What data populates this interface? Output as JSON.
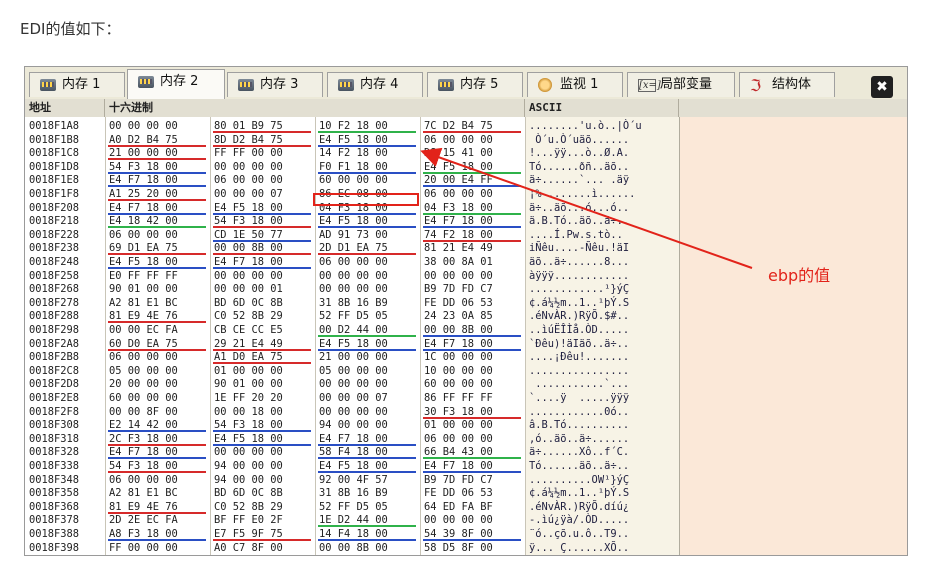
{
  "caption": "EDI的值如下：",
  "tabs": [
    {
      "label": "内存 1",
      "icon": "memory-icon"
    },
    {
      "label": "内存 2",
      "icon": "memory-icon",
      "active": true
    },
    {
      "label": "内存 3",
      "icon": "memory-icon"
    },
    {
      "label": "内存 4",
      "icon": "memory-icon"
    },
    {
      "label": "内存 5",
      "icon": "memory-icon"
    },
    {
      "label": "监视 1",
      "icon": "watch-icon"
    },
    {
      "label": "局部变量",
      "icon": "x-icon",
      "icon_text": "[x=]"
    },
    {
      "label": "结构体",
      "icon": "struct-icon",
      "icon_text": "ℑ"
    }
  ],
  "close_glyph": "✖",
  "headers": {
    "address": "地址",
    "hex": "十六进制",
    "ascii": "ASCII"
  },
  "rows": [
    {
      "addr": "0018F1A8",
      "hex": [
        "00 00 00 00",
        "80 01 B9 75",
        "10 F2 18 00",
        "7C D2 B4 75"
      ],
      "ascii": "........'u.ò..|Ò´u"
    },
    {
      "addr": "0018F1B8",
      "hex": [
        "A0 D2 B4 75",
        "8D D2 B4 75",
        "E4 F5 18 00",
        "06 00 00 00"
      ],
      "ascii": " Ò´u.Ò´uäõ......"
    },
    {
      "addr": "0018F1C8",
      "hex": [
        "21 00 00 00",
        "FF FF 00 00",
        "14 F2 18 00",
        "D8 15 41 00"
      ],
      "ascii": "!...ÿÿ...ò..Ø.A."
    },
    {
      "addr": "0018F1D8",
      "hex": [
        "54 F3 18 00",
        "00 00 00 00",
        "F0 F1 18 00",
        "E4 F5 18 00"
      ],
      "ascii": "Tó......ðñ..äõ.."
    },
    {
      "addr": "0018F1E8",
      "hex": [
        "E4 F7 18 00",
        "06 00 00 00",
        "60 00 00 00",
        "20 00 E4 FF"
      ],
      "ascii": "ä÷......`... .äÿ"
    },
    {
      "addr": "0018F1F8",
      "hex": [
        "A1 25 20 00",
        "00 00 00 07",
        "86 EC 08 00",
        "06 00 00 00"
      ],
      "ascii": "¡% .......ì......"
    },
    {
      "addr": "0018F208",
      "hex": [
        "E4 F7 18 00",
        "E4 F5 18 00",
        "04 F3 18 00",
        "04 F3 18 00"
      ],
      "ascii": "ä÷..äõ...ó...ó.."
    },
    {
      "addr": "0018F218",
      "hex": [
        "E4 18 42 00",
        "54 F3 18 00",
        "E4 F5 18 00",
        "E4 F7 18 00"
      ],
      "ascii": "ä.B.Tó..äõ..ä÷.."
    },
    {
      "addr": "0018F228",
      "hex": [
        "06 00 00 00",
        "CD 1E 50 77",
        "AD 91 73 00",
        "74 F2 18 00"
      ],
      "ascii": "....Í.Pw­.s.tò.."
    },
    {
      "addr": "0018F238",
      "hex": [
        "69 D1 EA 75",
        "00 00 8B 00",
        "2D D1 EA 75",
        "81 21 E4 49"
      ],
      "ascii": "iÑêu....-Ñêu.!äI"
    },
    {
      "addr": "0018F248",
      "hex": [
        "E4 F5 18 00",
        "E4 F7 18 00",
        "06 00 00 00",
        "38 00 8A 01"
      ],
      "ascii": "äõ..ä÷......8..."
    },
    {
      "addr": "0018F258",
      "hex": [
        "E0 FF FF FF",
        "00 00 00 00",
        "00 00 00 00",
        "00 00 00 00"
      ],
      "ascii": "àÿÿÿ............"
    },
    {
      "addr": "0018F268",
      "hex": [
        "90 01 00 00",
        "00 00 00 01",
        "00 00 00 00",
        "B9 7D FD C7"
      ],
      "ascii": "............¹}ýÇ"
    },
    {
      "addr": "0018F278",
      "hex": [
        "A2 81 E1 BC",
        "BD 6D 0C 8B",
        "31 8B 16 B9",
        "FE DD 06 53"
      ],
      "ascii": "¢.á¼½m..1..¹þÝ.S"
    },
    {
      "addr": "0018F288",
      "hex": [
        "81 E9 4E 76",
        "C0 52 8B 29",
        "52 FF D5 05",
        "24 23 0A 85"
      ],
      "ascii": ".éNvÀR.)RÿÕ.$#.."
    },
    {
      "addr": "0018F298",
      "hex": [
        "00 00 EC FA",
        "CB CE CC E5",
        "00 D2 44 00",
        "00 00 8B 00"
      ],
      "ascii": "..ìúËÎÌå.ÒD....."
    },
    {
      "addr": "0018F2A8",
      "hex": [
        "60 D0 EA 75",
        "29 21 E4 49",
        "E4 F5 18 00",
        "E4 F7 18 00"
      ],
      "ascii": "`Ðêu)!äIäõ..ä÷.."
    },
    {
      "addr": "0018F2B8",
      "hex": [
        "06 00 00 00",
        "A1 D0 EA 75",
        "21 00 00 00",
        "1C 00 00 00"
      ],
      "ascii": "....¡Ðêu!......."
    },
    {
      "addr": "0018F2C8",
      "hex": [
        "05 00 00 00",
        "01 00 00 00",
        "05 00 00 00",
        "10 00 00 00"
      ],
      "ascii": "................"
    },
    {
      "addr": "0018F2D8",
      "hex": [
        "20 00 00 00",
        "90 01 00 00",
        "00 00 00 00",
        "60 00 00 00"
      ],
      "ascii": " ...........`..."
    },
    {
      "addr": "0018F2E8",
      "hex": [
        "60 00 00 00",
        "1E FF 20 20",
        "00 00 00 07",
        "86 FF FF FF"
      ],
      "ascii": "`....ÿ  .....ÿÿÿ"
    },
    {
      "addr": "0018F2F8",
      "hex": [
        "00 00 8F 00",
        "00 00 18 00",
        "00 00 00 00",
        "30 F3 18 00"
      ],
      "ascii": "............0ó.."
    },
    {
      "addr": "0018F308",
      "hex": [
        "E2 14 42 00",
        "54 F3 18 00",
        "94 00 00 00",
        "01 00 00 00"
      ],
      "ascii": "â.B.Tó.........."
    },
    {
      "addr": "0018F318",
      "hex": [
        "2C F3 18 00",
        "E4 F5 18 00",
        "E4 F7 18 00",
        "06 00 00 00"
      ],
      "ascii": ",ó..äõ..ä÷......"
    },
    {
      "addr": "0018F328",
      "hex": [
        "E4 F7 18 00",
        "00 00 00 00",
        "58 F4 18 00",
        "66 B4 43 00"
      ],
      "ascii": "ä÷......Xô..f´C."
    },
    {
      "addr": "0018F338",
      "hex": [
        "54 F3 18 00",
        "94 00 00 00",
        "E4 F5 18 00",
        "E4 F7 18 00"
      ],
      "ascii": "Tó......äõ..ä÷.."
    },
    {
      "addr": "0018F348",
      "hex": [
        "06 00 00 00",
        "94 00 00 00",
        "92 00 4F 57",
        "B9 7D FD C7"
      ],
      "ascii": "..........OW¹}ýÇ"
    },
    {
      "addr": "0018F358",
      "hex": [
        "A2 81 E1 BC",
        "BD 6D 0C 8B",
        "31 8B 16 B9",
        "FE DD 06 53"
      ],
      "ascii": "¢.á¼½m..1..¹þÝ.S"
    },
    {
      "addr": "0018F368",
      "hex": [
        "81 E9 4E 76",
        "C0 52 8B 29",
        "52 FF D5 05",
        "64 ED FA BF"
      ],
      "ascii": ".éNvÀR.)RÿÕ.díú¿"
    },
    {
      "addr": "0018F378",
      "hex": [
        "2D 2E EC FA",
        "BF FF E0 2F",
        "1E D2 44 00",
        "00 00 00 00"
      ],
      "ascii": "-.ìú¿ÿà/.ÒD....."
    },
    {
      "addr": "0018F388",
      "hex": [
        "A8 F3 18 00",
        "E7 F5 9F 75",
        "14 F4 18 00",
        "54 39 8F 00"
      ],
      "ascii": "¨ó..çõ.u.ô..T9.."
    },
    {
      "addr": "0018F398",
      "hex": [
        "FF 00 00 00",
        "A0 C7 8F 00",
        "00 00 8B 00",
        "58 D5 8F 00"
      ],
      "ascii": "ÿ... Ç......XÕ.."
    }
  ],
  "annotation": {
    "label": "ebp的值",
    "color": "#e2231a"
  }
}
